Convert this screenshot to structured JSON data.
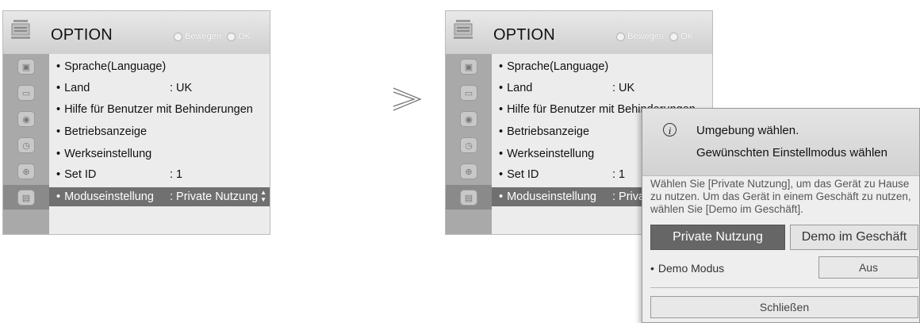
{
  "left_menu": {
    "title": "OPTION",
    "hint_move": "Bewegen",
    "hint_ok": "OK",
    "sidebar_icons": [
      "picture-icon",
      "audio-icon",
      "time-icon",
      "clock-icon",
      "lock-icon",
      "option-icon"
    ],
    "items": [
      {
        "label": "Sprache(Language)",
        "value": ""
      },
      {
        "label": "Land",
        "value": ": UK"
      },
      {
        "label": "Hilfe für Benutzer mit Behinderungen",
        "value": ""
      },
      {
        "label": "Betriebsanzeige",
        "value": ""
      },
      {
        "label": "Werkseinstellung",
        "value": ""
      },
      {
        "label": "Set ID",
        "value": ": 1"
      },
      {
        "label": "Moduseinstellung",
        "value": ": Private Nutzung"
      }
    ],
    "selected_index": 6
  },
  "right_menu": {
    "title": "OPTION",
    "hint_move": "Bewegen",
    "hint_ok": "OK",
    "items": [
      {
        "label": "Sprache(Language)",
        "value": ""
      },
      {
        "label": "Land",
        "value": ": UK"
      },
      {
        "label": "Hilfe für Benutzer mit Behinderungen",
        "value": ""
      },
      {
        "label": "Betriebsanzeige",
        "value": ""
      },
      {
        "label": "Werkseinstellung",
        "value": ""
      },
      {
        "label": "Set ID",
        "value": ": 1"
      },
      {
        "label": "Moduseinstellung",
        "value": ": Private Nutzung"
      }
    ]
  },
  "dialog": {
    "title_line1": "Umgebung wählen.",
    "title_line2": "Gewünschten Einstellmodus wählen",
    "description": "Wählen Sie [Private Nutzung], um das Gerät zu Hause zu nutzen. Um das Gerät in einem Geschäft zu nutzen, wählen Sie [Demo im Geschäft].",
    "private_label": "Private Nutzung",
    "demo_store_label": "Demo im Geschäft",
    "demo_mode_label": "Demo Modus",
    "demo_mode_value": "Aus",
    "close_label": "Schließen"
  },
  "colors": {
    "menu_bg": "#ececec",
    "sidebar_bg": "#a9a9a9",
    "selected_bg": "#707070",
    "dialog_bg": "#eeeeee",
    "active_button_bg": "#666666"
  }
}
